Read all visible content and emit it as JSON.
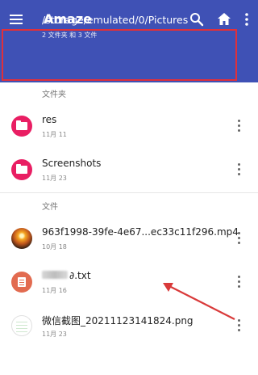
{
  "app": {
    "title": "Amaze"
  },
  "toolbar": {
    "icons": [
      "menu-icon",
      "search-icon",
      "home-icon",
      "more-vert-icon"
    ]
  },
  "path": {
    "current": "/storage/emulated/0/Pictures",
    "summary": "2 文件夹 和 3 文件"
  },
  "sections": {
    "folders_label": "文件夹",
    "files_label": "文件"
  },
  "folders": [
    {
      "name": "res",
      "date": "11月 11",
      "icon": "folder-icon"
    },
    {
      "name": "Screenshots",
      "date": "11月 23",
      "icon": "folder-icon"
    }
  ],
  "files": [
    {
      "name": "963f1998-39fe-4e67...ec33c11f296.mp4",
      "date": "10月 18",
      "icon": "video-thumbnail"
    },
    {
      "name": "∂.txt",
      "date": "11月 16",
      "icon": "document-icon",
      "name_partially_redacted": true
    },
    {
      "name": "微信截图_20211123141824.png",
      "date": "11月 23",
      "icon": "image-thumbnail"
    }
  ],
  "colors": {
    "appbar": "#3f51b5",
    "folder": "#e91e63",
    "document": "#e26b50",
    "highlight_box": "#e0303a",
    "annotation_arrow": "#d93a3a"
  }
}
